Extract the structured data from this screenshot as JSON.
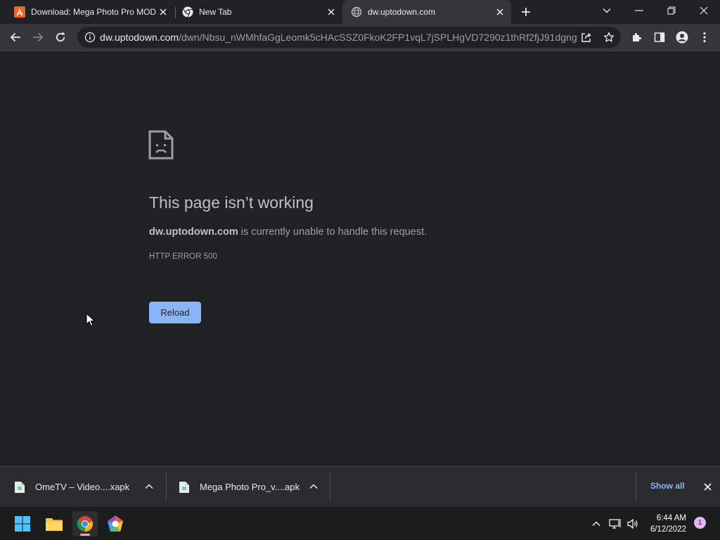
{
  "tabs": [
    {
      "title": "Download: Mega Photo Pro MOD",
      "favicon": "uptodown-icon",
      "active": false
    },
    {
      "title": "New Tab",
      "favicon": "chrome-icon",
      "active": false
    },
    {
      "title": "dw.uptodown.com",
      "favicon": "globe-icon",
      "active": true
    }
  ],
  "omnibox": {
    "host": "dw.uptodown.com",
    "path": "/dwn/Nbsu_nWMhfaGgLeomk5cHAcSSZ0FkoK2FP1vqL7jSPLHgVD7290z1thRf2fjJ91dgng..."
  },
  "error_page": {
    "title": "This page isn’t working",
    "host": "dw.uptodown.com",
    "message": " is currently unable to handle this request.",
    "code": "HTTP ERROR 500",
    "reload_label": "Reload"
  },
  "downloads": {
    "items": [
      {
        "name": "OmeTV – Video....xapk"
      },
      {
        "name": "Mega Photo Pro_v....apk"
      }
    ],
    "show_all_label": "Show all"
  },
  "taskbar": {
    "apps": [
      "start-icon",
      "file-explorer-icon",
      "chrome-icon",
      "app-icon"
    ],
    "time": "6:44 AM",
    "date": "6/12/2022",
    "notification_count": "1"
  },
  "colors": {
    "background": "#202124",
    "toolbar": "#35363a",
    "accent": "#8ab4f8"
  }
}
